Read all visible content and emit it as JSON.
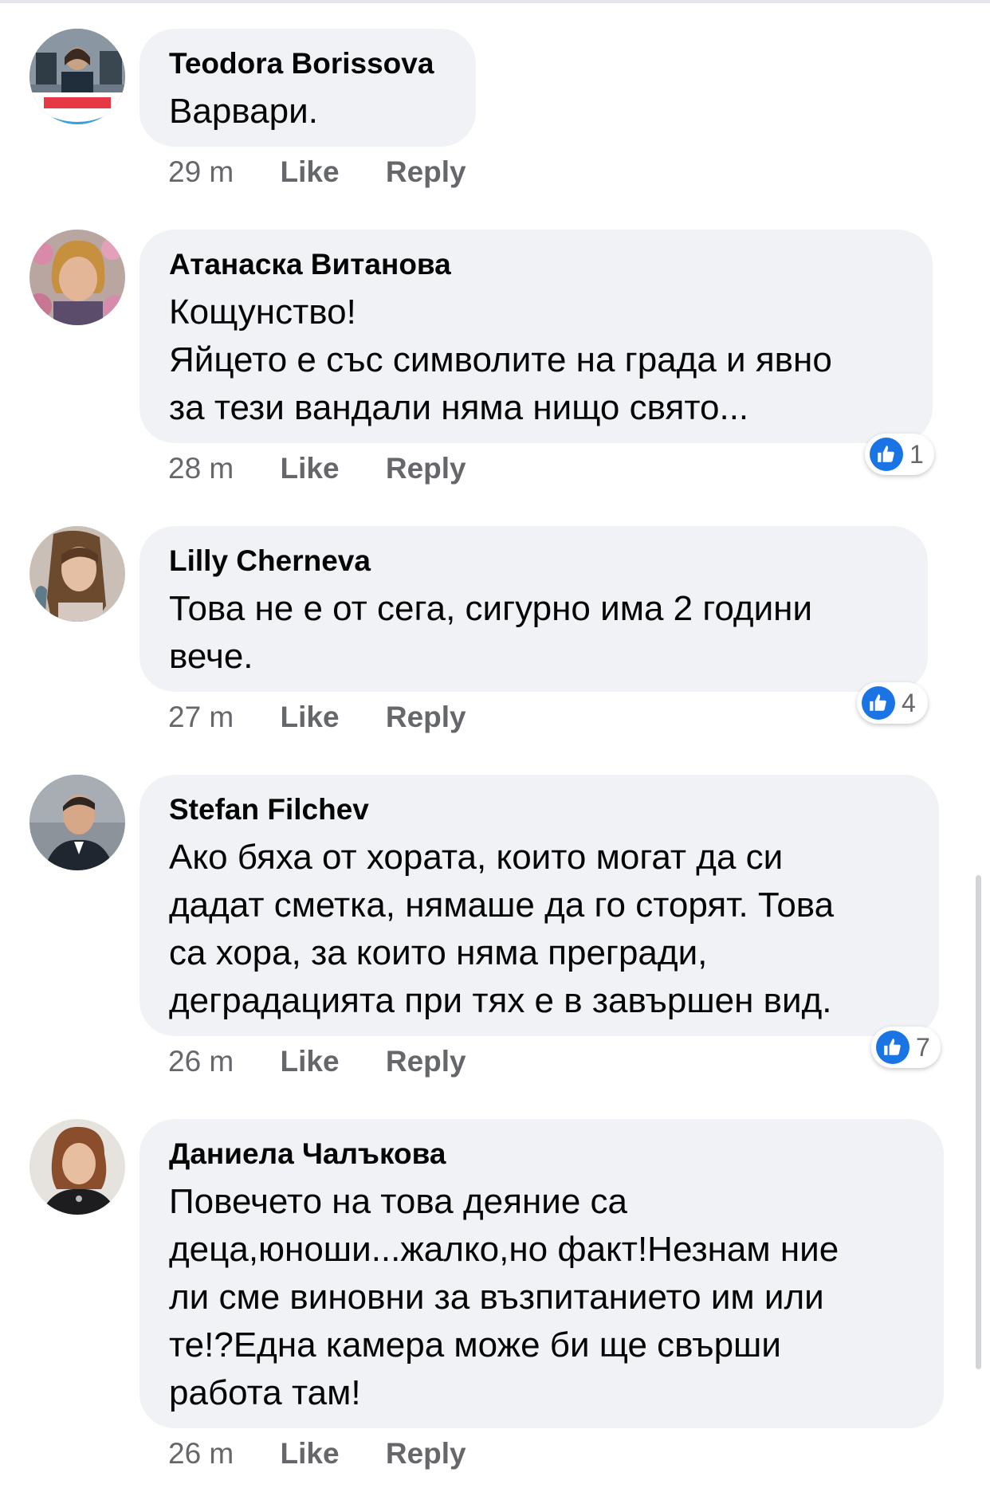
{
  "comments": [
    {
      "author": "Teodora Borissova",
      "lines": [
        "Варвари."
      ],
      "time": "29 m",
      "like_label": "Like",
      "reply_label": "Reply",
      "reactions": null,
      "avatar_badge": "ЩЕ СЕ СПРАВИМ ЗАЕДНО"
    },
    {
      "author": "Атанаска Витанова",
      "lines": [
        "Кощунство!",
        "Яйцето е със символите на града и явно",
        "за тези вандали няма нищо свято..."
      ],
      "time": "28 m",
      "like_label": "Like",
      "reply_label": "Reply",
      "reactions": "1"
    },
    {
      "author": "Lilly Cherneva",
      "lines": [
        "Това не е от сега, сигурно има 2 години",
        "вече."
      ],
      "time": "27 m",
      "like_label": "Like",
      "reply_label": "Reply",
      "reactions": "4"
    },
    {
      "author": "Stefan Filchev",
      "lines": [
        "Ако бяха от хората, които могат да си",
        "дадат сметка, нямаше да го сторят. Това",
        "са хора, за които няма прегради,",
        "деградацията при тях е в завършен вид."
      ],
      "time": "26 m",
      "like_label": "Like",
      "reply_label": "Reply",
      "reactions": "7"
    },
    {
      "author": "Даниела Чалъкова",
      "lines": [
        "Повечето на това деяние са",
        "деца,юноши...жалко,но факт!Незнам ние",
        "ли сме виновни за възпитанието им или",
        "те!?Една камера може би ще свърши",
        "работа там!"
      ],
      "time": "26 m",
      "like_label": "Like",
      "reply_label": "Reply",
      "reactions": null
    }
  ],
  "icons": {
    "reaction": "like-thumb-icon"
  },
  "colors": {
    "bubble": "#f0f2f5",
    "meta_text": "#65676b",
    "like_blue": "#1b74e4"
  }
}
